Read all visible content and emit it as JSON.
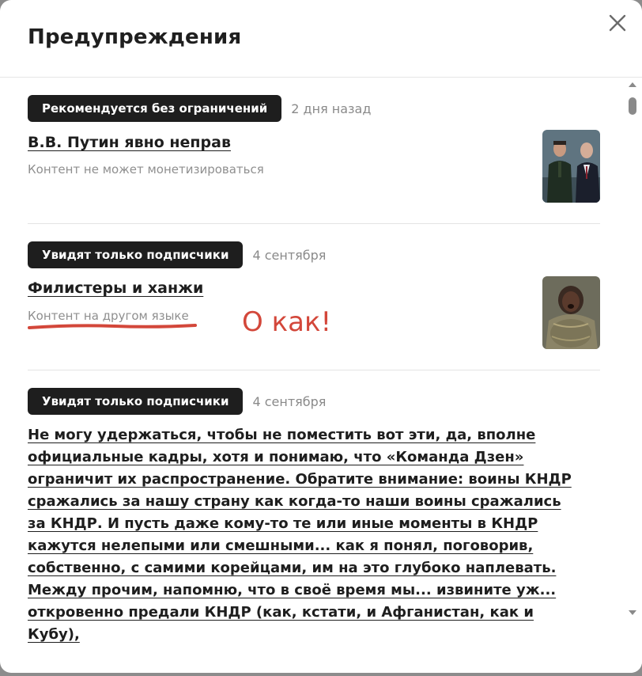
{
  "modal": {
    "title": "Предупреждения",
    "close_icon": "close-icon"
  },
  "warnings": [
    {
      "badge": "Рекомендуется без ограничений",
      "date": "2 дня назад",
      "title": "В.В. Путин явно неправ",
      "subtitle": "Контент не может монетизироваться",
      "thumbnail": "two-men-photo"
    },
    {
      "badge": "Увидят только подписчики",
      "date": "4 сентября",
      "title": "Филистеры и ханжи",
      "subtitle": "Контент на другом языке",
      "thumbnail": "armored-woman-photo"
    },
    {
      "badge": "Увидят только подписчики",
      "date": "4 сентября",
      "title_lines": [
        "Не могу удержаться, чтобы не поместить вот эти, да, вполне",
        "официальные кадры, хотя и понимаю, что «Команда Дзен»",
        "ограничит их распространение. Обратите внимание: воины КНДР",
        "сражались за нашу страну как когда-то наши воины сражались",
        "за КНДР. И пусть даже кому-то те или иные моменты в КНДР",
        "кажутся нелепыми или смешными... как я понял, поговорив,",
        "собственно, с самими корейцами, им на это глубоко наплевать.",
        "Между прочим, напомню, что в своё время мы... извините уж...",
        "откровенно предали КНДР (как, кстати, и Афганистан, как и Кубу),"
      ]
    }
  ],
  "annotation": {
    "text": "О как!",
    "color": "#d3473a"
  },
  "colors": {
    "badge_bg": "#1e1e1e",
    "accent_red": "#d3473a"
  }
}
